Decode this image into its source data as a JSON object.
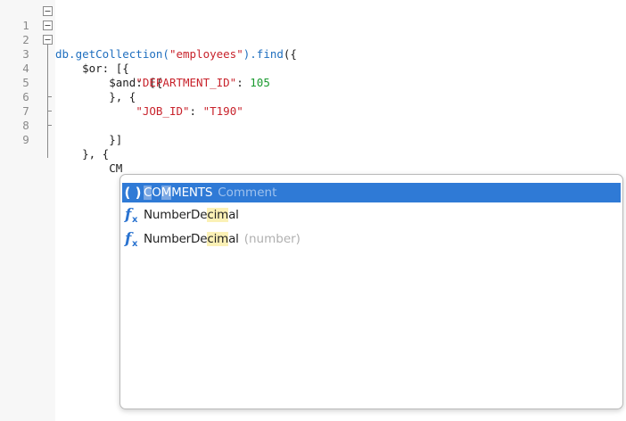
{
  "editor": {
    "lines": [
      {
        "number": "1",
        "segments": [
          {
            "t": "db.",
            "c": "kw-blue"
          },
          {
            "t": "getCollection(",
            "c": "kw-blue"
          },
          {
            "t": "\"employees\"",
            "c": "str-red"
          },
          {
            "t": ").",
            "c": "kw-blue"
          },
          {
            "t": "find",
            "c": "kw-blue"
          },
          {
            "t": "({",
            "c": ""
          }
        ]
      },
      {
        "number": "2",
        "segments": [
          {
            "t": "    $or: [{",
            "c": ""
          }
        ]
      },
      {
        "number": "3",
        "segments": [
          {
            "t": "        $and: [{",
            "c": ""
          }
        ]
      },
      {
        "number": "4",
        "segments": [
          {
            "t": "            ",
            "c": ""
          },
          {
            "t": "\"DEPARTMENT_ID\"",
            "c": "str-red"
          },
          {
            "t": ": ",
            "c": ""
          },
          {
            "t": "105",
            "c": "num-green"
          }
        ]
      },
      {
        "number": "5",
        "segments": [
          {
            "t": "        }, {",
            "c": ""
          }
        ]
      },
      {
        "number": "6",
        "segments": [
          {
            "t": "            ",
            "c": ""
          },
          {
            "t": "\"JOB_ID\"",
            "c": "str-red"
          },
          {
            "t": ": ",
            "c": ""
          },
          {
            "t": "\"T190\"",
            "c": "str-red"
          }
        ]
      },
      {
        "number": "7",
        "segments": [
          {
            "t": "        }]",
            "c": ""
          }
        ]
      },
      {
        "number": "8",
        "segments": [
          {
            "t": "    }, {",
            "c": ""
          }
        ]
      },
      {
        "number": "9",
        "segments": [
          {
            "t": "        CM",
            "c": ""
          }
        ]
      }
    ]
  },
  "autocomplete": {
    "items": [
      {
        "icon": "parentheses-icon",
        "pre": "",
        "match": "C",
        "mid": "O",
        "match2": "M",
        "rest": "MENTS",
        "hint": "Comment",
        "selected": true
      },
      {
        "icon": "function-icon",
        "pre": "NumberDe",
        "match": "c",
        "mid": "i",
        "match2": "m",
        "rest": "al",
        "hint": "",
        "selected": false
      },
      {
        "icon": "function-icon",
        "pre": "NumberDe",
        "match": "c",
        "mid": "i",
        "match2": "m",
        "rest": "al",
        "hint": "(number)",
        "selected": false
      }
    ]
  },
  "colors": {
    "keyword": "#1f6fbf",
    "string": "#c8232c",
    "number": "#1a9a2f",
    "selection": "#2f7ad6",
    "match_highlight": "#fbf1b6"
  }
}
